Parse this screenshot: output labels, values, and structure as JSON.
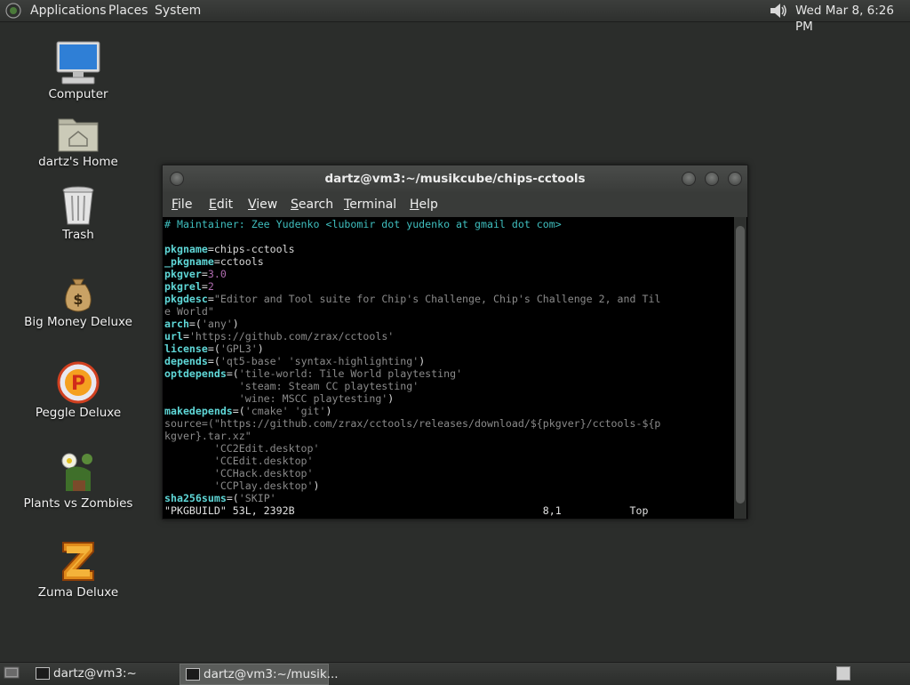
{
  "top_panel": {
    "menus": [
      "Applications",
      "Places",
      "System"
    ],
    "clock": "Wed Mar  8,  6:26 PM",
    "icons": {
      "logo": "gnome-foot-icon",
      "volume": "volume-icon"
    }
  },
  "desktop": {
    "icons": [
      {
        "label": "Computer",
        "icon": "computer-icon"
      },
      {
        "label": "dartz's Home",
        "icon": "home-folder-icon"
      },
      {
        "label": "Trash",
        "icon": "trash-icon"
      },
      {
        "label": "Big Money Deluxe",
        "icon": "money-bag-icon"
      },
      {
        "label": "Peggle Deluxe",
        "icon": "peggle-icon"
      },
      {
        "label": "Plants vs Zombies",
        "icon": "plants-vs-zombies-icon"
      },
      {
        "label": "Zuma Deluxe",
        "icon": "zuma-icon"
      }
    ]
  },
  "terminal": {
    "title": "dartz@vm3:~/musikcube/chips-cctools",
    "menu": [
      {
        "label": "File",
        "mnemonic": "F",
        "rest": "ile"
      },
      {
        "label": "Edit",
        "mnemonic": "E",
        "rest": "dit"
      },
      {
        "label": "View",
        "mnemonic": "V",
        "rest": "iew"
      },
      {
        "label": "Search",
        "mnemonic": "S",
        "rest": "earch"
      },
      {
        "label": "Terminal",
        "mnemonic": "T",
        "rest": "erminal"
      },
      {
        "label": "Help",
        "mnemonic": "H",
        "rest": "elp"
      }
    ],
    "lines": [
      [
        {
          "t": "# Maintainer: Zee Yudenko <lubomir dot yudenko at gmail dot com>",
          "c": "cm"
        }
      ],
      [],
      [
        {
          "t": "pkgname",
          "c": "kw"
        },
        {
          "t": "=chips-cctools",
          "c": "plain"
        }
      ],
      [
        {
          "t": "_pkgname",
          "c": "kw"
        },
        {
          "t": "=cctools",
          "c": "plain"
        }
      ],
      [
        {
          "t": "pkgver",
          "c": "kw"
        },
        {
          "t": "=",
          "c": "plain"
        },
        {
          "t": "3.0",
          "c": "num"
        }
      ],
      [
        {
          "t": "pkgrel",
          "c": "kw"
        },
        {
          "t": "=",
          "c": "plain"
        },
        {
          "t": "2",
          "c": "num"
        }
      ],
      [
        {
          "t": "pkgdesc",
          "c": "kw"
        },
        {
          "t": "=",
          "c": "plain"
        },
        {
          "t": "\"Editor and Tool suite for Chip's Challenge, Chip's Challenge 2, and Til",
          "c": "str"
        }
      ],
      [
        {
          "t": "e World\"",
          "c": "str"
        }
      ],
      [
        {
          "t": "arch",
          "c": "kw"
        },
        {
          "t": "=(",
          "c": "plain"
        },
        {
          "t": "'any'",
          "c": "str"
        },
        {
          "t": ")",
          "c": "plain"
        }
      ],
      [
        {
          "t": "url",
          "c": "kw"
        },
        {
          "t": "=",
          "c": "plain"
        },
        {
          "t": "'https://github.com/zrax/cctools'",
          "c": "str"
        }
      ],
      [
        {
          "t": "license",
          "c": "kw"
        },
        {
          "t": "=(",
          "c": "plain"
        },
        {
          "t": "'GPL3'",
          "c": "str"
        },
        {
          "t": ")",
          "c": "plain"
        }
      ],
      [
        {
          "t": "depends",
          "c": "kw"
        },
        {
          "t": "=(",
          "c": "plain"
        },
        {
          "t": "'qt5-base' 'syntax-highlighting'",
          "c": "str"
        },
        {
          "t": ")",
          "c": "plain"
        }
      ],
      [
        {
          "t": "optdepends",
          "c": "kw"
        },
        {
          "t": "=(",
          "c": "plain"
        },
        {
          "t": "'tile-world: Tile World playtesting'",
          "c": "str"
        }
      ],
      [
        {
          "t": "            'steam: Steam CC playtesting'",
          "c": "str"
        }
      ],
      [
        {
          "t": "            'wine: MSCC playtesting'",
          "c": "str"
        },
        {
          "t": ")",
          "c": "plain"
        }
      ],
      [
        {
          "t": "makedepends",
          "c": "kw"
        },
        {
          "t": "=(",
          "c": "plain"
        },
        {
          "t": "'cmake' 'git'",
          "c": "str"
        },
        {
          "t": ")",
          "c": "plain"
        }
      ],
      [
        {
          "t": "source=(\"https://github.com/zrax/cctools/releases/download/${pkgver}/cctools-${p",
          "c": "str"
        }
      ],
      [
        {
          "t": "kgver}.tar.xz\"",
          "c": "str"
        }
      ],
      [
        {
          "t": "        'CC2Edit.desktop'",
          "c": "str"
        }
      ],
      [
        {
          "t": "        'CCEdit.desktop'",
          "c": "str"
        }
      ],
      [
        {
          "t": "        'CCHack.desktop'",
          "c": "str"
        }
      ],
      [
        {
          "t": "        'CCPlay.desktop'",
          "c": "str"
        },
        {
          "t": ")",
          "c": "plain"
        }
      ],
      [
        {
          "t": "sha256sums",
          "c": "kw"
        },
        {
          "t": "=(",
          "c": "plain"
        },
        {
          "t": "'SKIP'",
          "c": "str"
        }
      ],
      [
        {
          "t": "\"PKGBUILD\" 53L, 2392B                                        8,1           Top",
          "c": "stat"
        }
      ]
    ]
  },
  "taskbar": {
    "tasks": [
      {
        "label": "dartz@vm3:~",
        "active": false
      },
      {
        "label": "dartz@vm3:~/musik...",
        "active": true
      }
    ],
    "icons": {
      "show_desktop": "show-desktop-icon",
      "workspace": "workspace-switcher-icon"
    }
  },
  "colors": {
    "desktop_bg": "#2b2d2b",
    "terminal_bg": "#000000",
    "keyword": "#5fd7d7",
    "comment": "#3fbfbf",
    "string": "#8a8a8a",
    "number": "#b06cb0"
  }
}
